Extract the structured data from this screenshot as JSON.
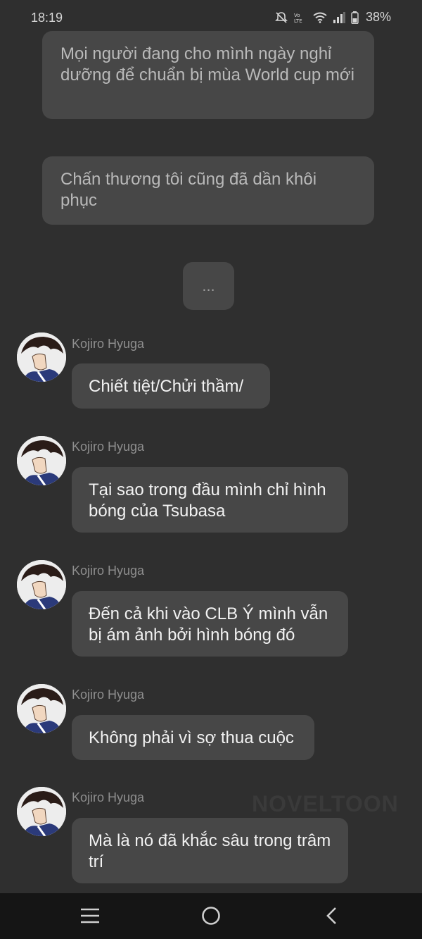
{
  "status_bar": {
    "time": "18:19",
    "battery_percent": "38%",
    "icons": [
      "mute-icon",
      "volte-icon",
      "wifi-icon",
      "signal-icon",
      "battery-icon"
    ]
  },
  "narration": [
    {
      "text": "Mọi người đang cho mình ngày nghỉ dưỡng để chuẩn bị mùa World cup mới"
    },
    {
      "text": "Chấn thương tôi cũng đã dần khôi phục"
    },
    {
      "text": "..."
    }
  ],
  "messages": [
    {
      "sender": "Kojiro Hyuga",
      "text": "Chiết tiệt/Chửi thầm/"
    },
    {
      "sender": "Kojiro Hyuga",
      "text": "Tại sao trong đầu mình chỉ hình bóng của Tsubasa"
    },
    {
      "sender": "Kojiro Hyuga",
      "text": "Đến cả khi vào CLB Ý mình vẫn bị ám ảnh bởi hình bóng đó"
    },
    {
      "sender": "Kojiro Hyuga",
      "text": "Không phải vì sợ thua cuộc"
    },
    {
      "sender": "Kojiro Hyuga",
      "text": "Mà là nó đã khắc sâu trong trâm trí"
    }
  ],
  "watermark": "NOVELTOON",
  "nav_bar": {
    "buttons": [
      "menu-icon",
      "home-icon",
      "back-icon"
    ]
  },
  "colors": {
    "background": "#2f2f2f",
    "bubble": "#474747",
    "nav_bar": "#151515",
    "sender_text": "#8e8e8e"
  }
}
